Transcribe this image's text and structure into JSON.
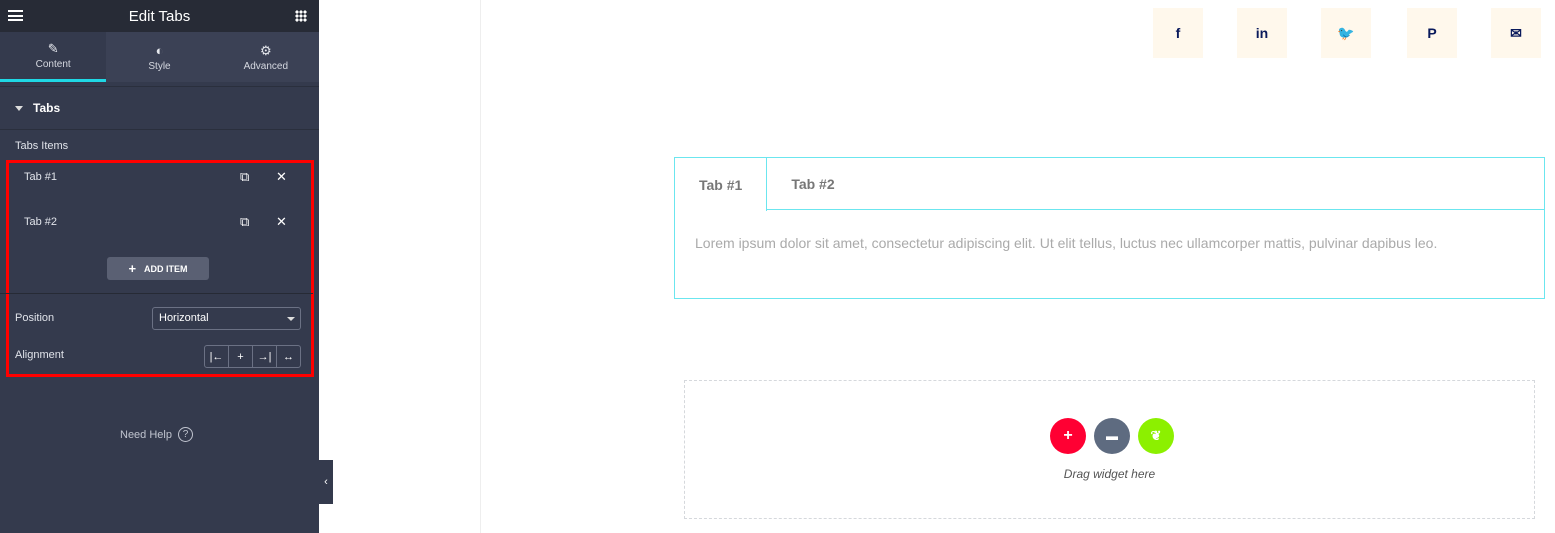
{
  "panel": {
    "title": "Edit Tabs",
    "tabs": [
      {
        "label": "Content",
        "icon": "pencil-icon"
      },
      {
        "label": "Style",
        "icon": "contrast-icon"
      },
      {
        "label": "Advanced",
        "icon": "gear-icon"
      }
    ],
    "section": "Tabs",
    "items_label": "Tabs Items",
    "items": [
      "Tab #1",
      "Tab #2"
    ],
    "add_item": "ADD ITEM",
    "position_label": "Position",
    "position_value": "Horizontal",
    "alignment_label": "Alignment",
    "help": "Need Help"
  },
  "social": [
    "facebook-icon",
    "linkedin-icon",
    "twitter-icon",
    "pinterest-icon",
    "email-icon"
  ],
  "widget": {
    "tabs": [
      "Tab #1",
      "Tab #2"
    ],
    "active_tab": "Tab #1",
    "content": "Lorem ipsum dolor sit amet, consectetur adipiscing elit. Ut elit tellus, luctus nec ullamcorper mattis, pulvinar dapibus leo."
  },
  "dropzone": {
    "text": "Drag widget here"
  },
  "colors": {
    "accent": "#1fd8e5",
    "highlight": "#ff0000",
    "add": "#ff0033",
    "folder": "#5e6b80",
    "elementor_kit": "#8cf000"
  }
}
